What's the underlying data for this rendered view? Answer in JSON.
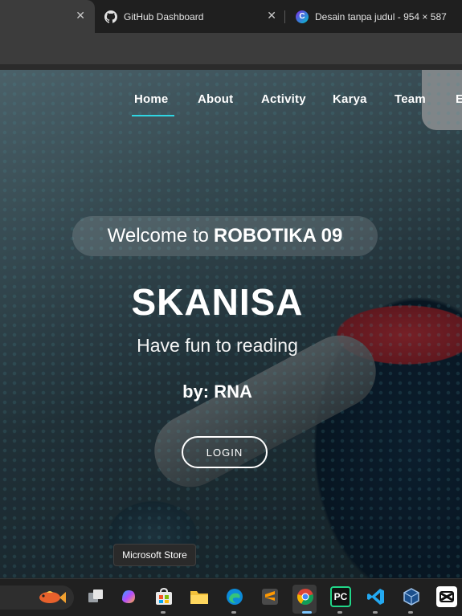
{
  "browser": {
    "tabs": [
      {
        "title": "",
        "close": "✕"
      },
      {
        "title": "GitHub Dashboard",
        "icon": "github-icon",
        "close": "✕"
      },
      {
        "title": "Desain tanpa judul - 954 × 587",
        "icon": "canva-icon"
      }
    ]
  },
  "site": {
    "nav": [
      {
        "label": "Home",
        "active": true
      },
      {
        "label": "About"
      },
      {
        "label": "Activity"
      },
      {
        "label": "Karya"
      },
      {
        "label": "Team"
      },
      {
        "label": "E"
      }
    ],
    "accent_color": "#2fd6e3",
    "hero": {
      "welcome_prefix": "Welcome to",
      "welcome_brand": "ROBOTIKA 09",
      "title": "SKANISA",
      "subtitle": "Have fun to reading",
      "byline": "by: RNA",
      "login_label": "LOGIN"
    }
  },
  "tooltip": {
    "text": "Microsoft Store"
  },
  "taskbar": {
    "icons": [
      {
        "name": "task-view-icon"
      },
      {
        "name": "copilot-icon"
      },
      {
        "name": "microsoft-store-icon"
      },
      {
        "name": "file-explorer-icon"
      },
      {
        "name": "edge-icon"
      },
      {
        "name": "sublime-text-icon"
      },
      {
        "name": "chrome-icon"
      },
      {
        "name": "pycharm-icon",
        "label": "PC"
      },
      {
        "name": "vscode-icon"
      },
      {
        "name": "virtualbox-icon"
      },
      {
        "name": "capcut-icon"
      }
    ]
  }
}
